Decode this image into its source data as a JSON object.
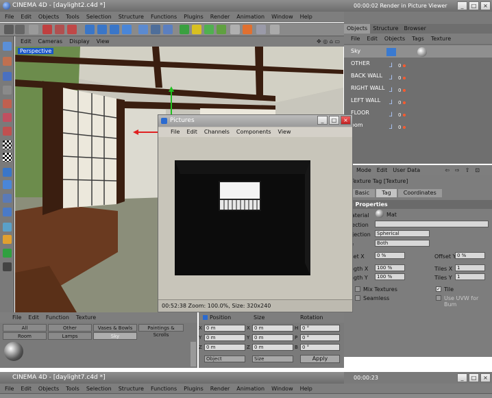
{
  "window": {
    "title": "CINEMA 4D - [daylight2.c4d *]",
    "render_status": "00:00:02   Render in Picture Viewer",
    "min": "_",
    "max": "□",
    "close": "×"
  },
  "menubar": [
    "File",
    "Edit",
    "Objects",
    "Tools",
    "Selection",
    "Structure",
    "Functions",
    "Plugins",
    "Render",
    "Animation",
    "Window",
    "Help"
  ],
  "viewport": {
    "menu": [
      "Edit",
      "Cameras",
      "Display",
      "View"
    ],
    "label": "Perspective"
  },
  "pictures": {
    "title": "Pictures",
    "menu": [
      "File",
      "Edit",
      "Channels",
      "Components",
      "View"
    ],
    "status": "00:52:38  Zoom: 100.0%, Size: 320x240"
  },
  "right_panel": {
    "tabs": [
      "Objects",
      "Structure",
      "Browser"
    ],
    "menu": [
      "File",
      "Edit",
      "Objects",
      "Tags",
      "Texture"
    ],
    "objects": [
      "Sky",
      "OTHER",
      "BACK WALL",
      "RIGHT WALL",
      "LEFT WALL",
      "FLOOR",
      "oom"
    ]
  },
  "attributes": {
    "menu": [
      "Mode",
      "Edit",
      "User Data"
    ],
    "header": "Texture Tag [Texture]",
    "tabs": [
      "Basic",
      "Tag",
      "Coordinates"
    ],
    "section": "g Properties",
    "material_label": "Material",
    "material_value": "Mat",
    "selection_label": "election",
    "projection_label": "rojection",
    "projection_value": "Spherical",
    "side_label": "de",
    "side_value": "Both",
    "offset_x_label": "ffset X",
    "offset_x_value": "0 %",
    "offset_y_label": "Offset Y",
    "offset_y_value": "0 %",
    "length_x_label": "ength X",
    "length_x_value": "100 %",
    "tiles_x_label": "Tiles X",
    "tiles_x_value": "1",
    "length_y_label": "ength Y",
    "length_y_value": "100 %",
    "tiles_y_label": "Tiles Y",
    "tiles_y_value": "1",
    "mix_textures": "Mix Textures",
    "tile": "Tile",
    "seamless": "Seamless",
    "use_uvw": "Use UVW for Bum"
  },
  "material_mgr": {
    "menu": [
      "File",
      "Edit",
      "Function",
      "Texture"
    ],
    "tabs": [
      "All",
      "Other",
      "Vases & Bowls",
      "Paintings & Scrolls",
      "Room",
      "Lamps",
      "Sky"
    ]
  },
  "coordinates": {
    "headers": [
      "Position",
      "Size",
      "Rotation"
    ],
    "rows": [
      {
        "axis": "X",
        "pos": "0 m",
        "saxis": "X",
        "size": "0 m",
        "raxis": "H",
        "rot": "0 °"
      },
      {
        "axis": "Y",
        "pos": "0 m",
        "saxis": "Y",
        "size": "0 m",
        "raxis": "P",
        "rot": "0 °"
      },
      {
        "axis": "Z",
        "pos": "0 m",
        "saxis": "Z",
        "size": "0 m",
        "raxis": "B",
        "rot": "0 °"
      }
    ],
    "mode1": "Object",
    "mode2": "Size",
    "apply": "Apply"
  },
  "second_window": {
    "title": "CINEMA 4D - [daylight7.c4d *]",
    "time": "00:00:23",
    "menubar": [
      "File",
      "Edit",
      "Objects",
      "Tools",
      "Selection",
      "Structure",
      "Functions",
      "Plugins",
      "Render",
      "Animation",
      "Window",
      "Help"
    ]
  },
  "colors": {
    "accent": "#1a56c8",
    "tag_dot": "#ff5a2d",
    "chrome": "#7a7a7a"
  }
}
